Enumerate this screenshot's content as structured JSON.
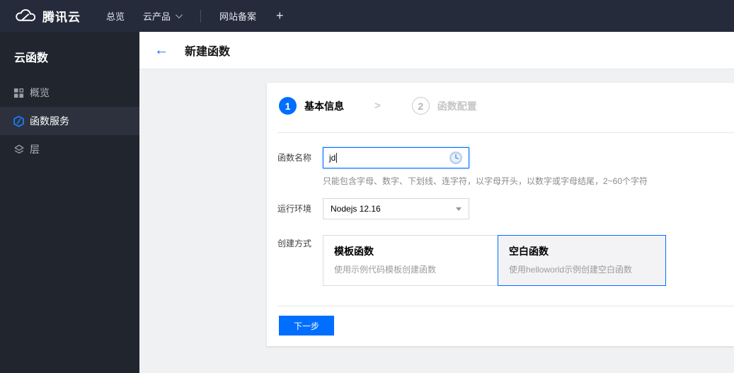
{
  "topbar": {
    "brand": "腾讯云",
    "nav": [
      {
        "label": "总览"
      },
      {
        "label": "云产品",
        "has_dropdown": true
      },
      {
        "label": "网站备案"
      }
    ]
  },
  "icons": {
    "plus": "+",
    "back_arrow": "←",
    "step_chevron": ">"
  },
  "sidebar": {
    "title": "云函数",
    "items": [
      {
        "label": "概览",
        "icon": "grid-icon",
        "selected": false
      },
      {
        "label": "函数服务",
        "icon": "function-icon",
        "selected": true
      },
      {
        "label": "层",
        "icon": "layers-icon",
        "selected": false
      }
    ]
  },
  "header": {
    "title": "新建函数"
  },
  "steps": [
    {
      "number": "1",
      "label": "基本信息",
      "active": true
    },
    {
      "number": "2",
      "label": "函数配置",
      "active": false
    }
  ],
  "form": {
    "name_label": "函数名称",
    "name_value": "jd",
    "name_help": "只能包含字母、数字、下划线、连字符，以字母开头，以数字或字母结尾，2~60个字符",
    "runtime_label": "运行环境",
    "runtime_value": "Nodejs 12.16",
    "method_label": "创建方式",
    "methods": [
      {
        "title": "模板函数",
        "desc": "使用示例代码模板创建函数",
        "selected": false
      },
      {
        "title": "空白函数",
        "desc": "使用helloworld示例创建空白函数",
        "selected": true
      }
    ]
  },
  "footer": {
    "next_label": "下一步"
  },
  "colors": {
    "accent": "#006eff",
    "topbar_bg": "#252b3b",
    "sidebar_bg": "#21252e",
    "sidebar_selected_bg": "#2c313d",
    "content_bg": "#f0f1f3",
    "selected_card_bg": "#f3f3f5"
  }
}
